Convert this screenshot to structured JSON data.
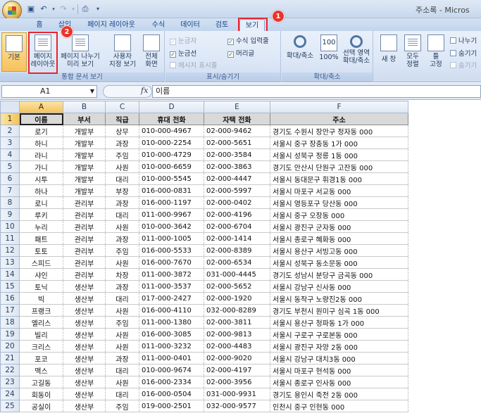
{
  "window": {
    "title": "주소록 - Micros"
  },
  "qat": {
    "save_icon": "floppy-disk-icon",
    "undo_icon": "undo-icon",
    "redo_icon": "redo-icon",
    "preview_icon": "print-preview-icon",
    "customize_icon": "customize-qat-icon"
  },
  "tabs": [
    {
      "label": "홈"
    },
    {
      "label": "삽입"
    },
    {
      "label": "페이지 레이아웃"
    },
    {
      "label": "수식"
    },
    {
      "label": "데이터"
    },
    {
      "label": "검토"
    },
    {
      "label": "보기"
    }
  ],
  "annotations": {
    "badge1": "1",
    "badge2": "2",
    "highlight_color": "#e8242d"
  },
  "ribbon": {
    "workbook_views": {
      "label": "통합 문서 보기",
      "normal": "기본",
      "page_layout_l1": "페이지",
      "page_layout_l2": "레이아웃",
      "page_break_l1": "페이지 나누기",
      "page_break_l2": "미리 보기",
      "custom_l1": "사용자",
      "custom_l2": "지정 보기",
      "fullscreen_l1": "전체",
      "fullscreen_l2": "화면"
    },
    "show_hide": {
      "label": "표시/숨기기",
      "ruler": "눈금자",
      "gridlines": "눈금선",
      "message_bar": "메시지 표시줄",
      "formula_bar": "수식 입력줄",
      "headings": "머리글"
    },
    "zoom": {
      "label": "확대/축소",
      "zoom_btn": "확대/축소",
      "zoom100": "100%",
      "zoom_sel_l1": "선택 영역",
      "zoom_sel_l2": "확대/축소"
    },
    "window": {
      "new_window": "새 창",
      "arrange_l1": "모두",
      "arrange_l2": "정렬",
      "freeze_l1": "틀",
      "freeze_l2": "고정",
      "split": "나누기",
      "hide": "숨기기",
      "unhide": "숨기기"
    }
  },
  "formula_bar": {
    "name_box": "A1",
    "fx": "fx",
    "value": "이름"
  },
  "sheet": {
    "columns": [
      "A",
      "B",
      "C",
      "D",
      "E",
      "F"
    ],
    "header": [
      "이름",
      "부서",
      "직급",
      "휴대 전화",
      "자택 전화",
      "주소"
    ],
    "rows": [
      [
        "로기",
        "개발부",
        "상무",
        "010-000-4967",
        "02-000-9462",
        "경기도 수원시 장안구 정자동 000"
      ],
      [
        "하니",
        "개발부",
        "과장",
        "010-000-2254",
        "02-000-5651",
        "서울시 중구 장충동 1가 000"
      ],
      [
        "라니",
        "개발부",
        "주임",
        "010-000-4729",
        "02-000-3584",
        "서울시 성북구 정릉 1동 000"
      ],
      [
        "가니",
        "개발부",
        "사원",
        "010-000-6659",
        "02-000-3863",
        "경기도 안산시 단원구 고잔동 000"
      ],
      [
        "시투",
        "개발부",
        "대리",
        "010-000-5545",
        "02-000-4447",
        "서울시 동대문구 휘경1동 000"
      ],
      [
        "하나",
        "개발부",
        "부장",
        "016-000-0831",
        "02-000-5997",
        "서울시 마포구 서교동 000"
      ],
      [
        "로니",
        "관리부",
        "과장",
        "016-000-1197",
        "02-000-0402",
        "서울시 영등포구 당산동 000"
      ],
      [
        "루키",
        "관리부",
        "대리",
        "011-000-9967",
        "02-000-4196",
        "서울시 중구 오장동 000"
      ],
      [
        "누리",
        "관리부",
        "사원",
        "010-000-3642",
        "02-000-6704",
        "서울시 광진구 군자동 000"
      ],
      [
        "패트",
        "관리부",
        "과장",
        "011-000-1005",
        "02-000-1414",
        "서울시 종로구 혜화동 000"
      ],
      [
        "토토",
        "관리부",
        "주임",
        "016-000-5533",
        "02-000-8389",
        "서울시 용산구 서빙고동 000"
      ],
      [
        "스피드",
        "관리부",
        "사원",
        "016-000-7670",
        "02-000-6534",
        "서울시 성북구 동소문동 000"
      ],
      [
        "샤인",
        "관리부",
        "차장",
        "011-000-3872",
        "031-000-4445",
        "경기도 성남시 분당구 금곡동 000"
      ],
      [
        "토닉",
        "생산부",
        "과장",
        "011-000-3537",
        "02-000-5652",
        "서울시 강남구 신사동 000"
      ],
      [
        "빅",
        "생산부",
        "대리",
        "017-000-2427",
        "02-000-1920",
        "서울시 동작구 노량진2동 000"
      ],
      [
        "프랭크",
        "생산부",
        "사원",
        "016-000-4110",
        "032-000-8289",
        "경기도 부천시 원미구 심곡 1동 000"
      ],
      [
        "엘리스",
        "생산부",
        "주임",
        "011-000-1380",
        "02-000-3811",
        "서울시 용산구 청파동 1가 000"
      ],
      [
        "빌리",
        "생산부",
        "사원",
        "016-000-3085",
        "02-000-9813",
        "서울시 구로구 구로본동 000"
      ],
      [
        "크리스",
        "생산부",
        "사원",
        "011-000-3232",
        "02-000-4483",
        "서울시 광진구 자양 2동 000"
      ],
      [
        "포코",
        "생산부",
        "과장",
        "011-000-0401",
        "02-000-9020",
        "서울시 강남구 대치3동 000"
      ],
      [
        "맥스",
        "생산부",
        "대리",
        "010-000-9674",
        "02-000-4197",
        "서울시 마포구 현석동 000"
      ],
      [
        "고길동",
        "생산부",
        "사원",
        "016-000-2334",
        "02-000-3956",
        "서울시 종로구 인사동 000"
      ],
      [
        "회동이",
        "생산부",
        "대리",
        "016-000-0504",
        "031-000-9931",
        "경기도 용인시 죽전 2동 000"
      ],
      [
        "공실이",
        "생산부",
        "주임",
        "019-000-2501",
        "032-000-9577",
        "인천시 중구 인현동 000"
      ]
    ]
  }
}
